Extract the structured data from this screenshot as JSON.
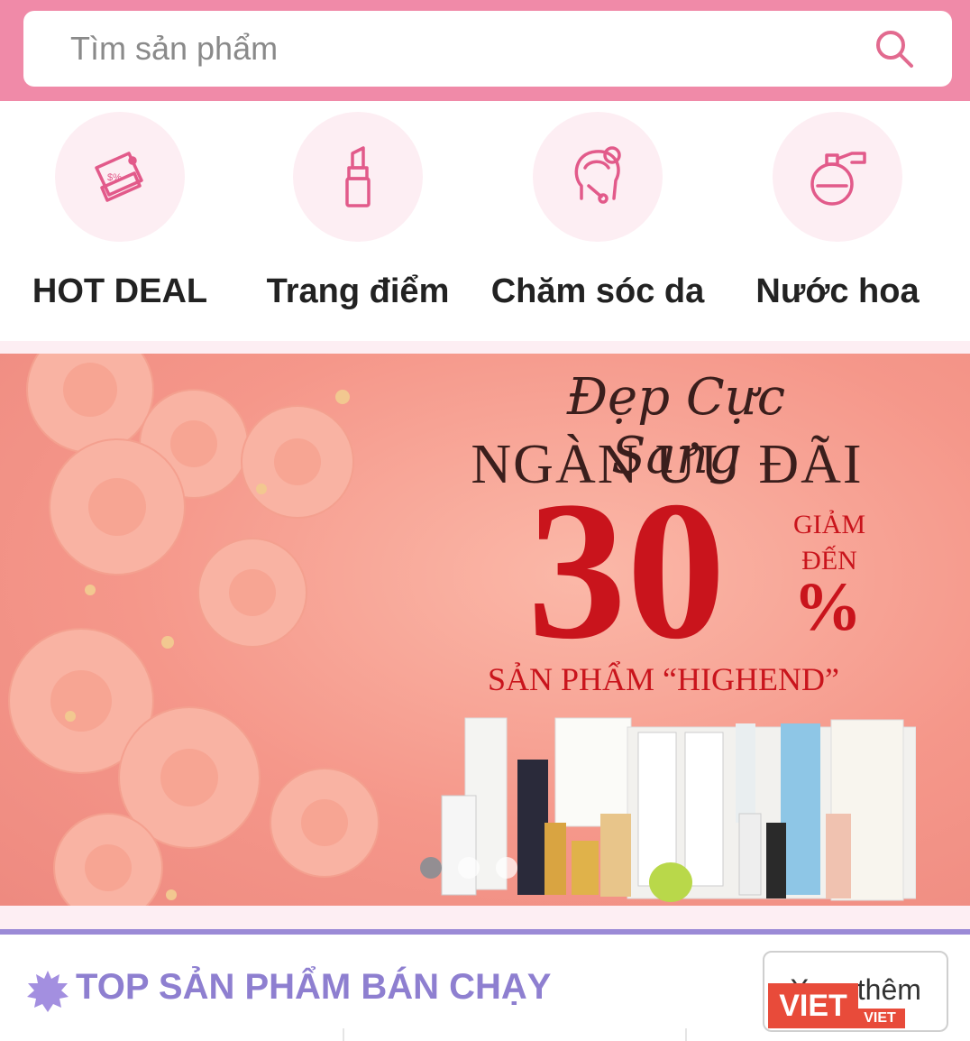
{
  "search": {
    "placeholder": "Tìm sản phẩm",
    "icon": "search-icon"
  },
  "categories": [
    {
      "label": "HOT DEAL",
      "icon": "tag-icon"
    },
    {
      "label": "Trang điểm",
      "icon": "lipstick-icon"
    },
    {
      "label": "Chăm sóc da",
      "icon": "skincare-face-icon"
    },
    {
      "label": "Nước hoa",
      "icon": "perfume-icon"
    }
  ],
  "banner": {
    "script_line": "Đẹp Cực Sang",
    "headline": "NGÀN ƯU ĐÃI",
    "discount": "30",
    "discount_prefix": "GIẢM ĐẾN",
    "percent": "%",
    "product_line": "SẢN PHẨM “HIGHEND”",
    "slide_dots": 3,
    "active_slide": 1
  },
  "top_section": {
    "title": "TOP SẢN PHẨM BÁN CHẠY",
    "more_label": "Xem thêm",
    "icon": "burst-star-icon"
  },
  "watermark": {
    "text": "VIET",
    "small": "VIET"
  },
  "colors": {
    "header_pink": "#f08aa8",
    "icon_pink": "#e25a8a",
    "soft_pink": "#fdeef3",
    "accent_purple": "#8e7fd0",
    "discount_red": "#c9141c"
  }
}
